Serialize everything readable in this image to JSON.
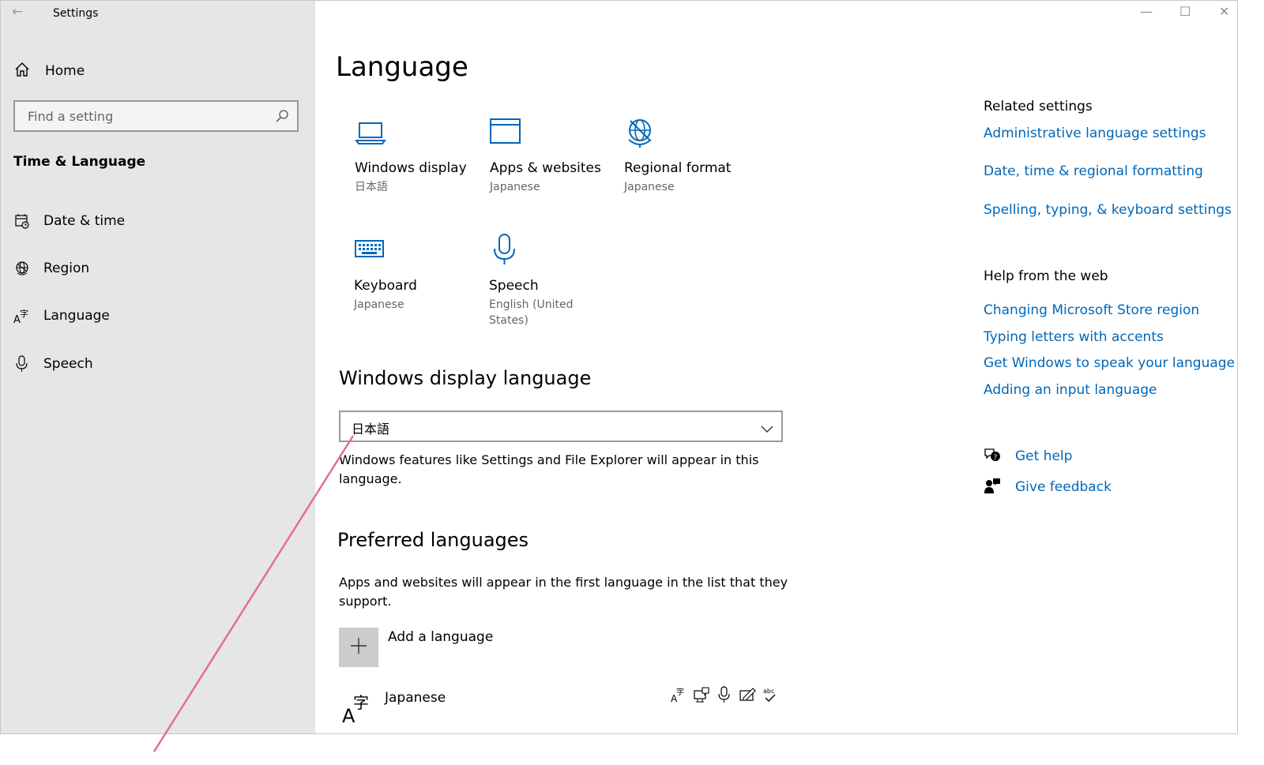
{
  "window": {
    "title": "Settings"
  },
  "sidebar": {
    "home_label": "Home",
    "search_placeholder": "Find a setting",
    "section_title": "Time & Language",
    "items": [
      {
        "label": "Date & time",
        "icon": "calendar-clock-icon"
      },
      {
        "label": "Region",
        "icon": "globe-icon"
      },
      {
        "label": "Language",
        "icon": "language-icon"
      },
      {
        "label": "Speech",
        "icon": "microphone-icon"
      }
    ]
  },
  "main": {
    "title": "Language",
    "tiles": [
      {
        "title": "Windows display",
        "subtitle": "日本語",
        "icon": "laptop-icon"
      },
      {
        "title": "Apps & websites",
        "subtitle": "Japanese",
        "icon": "window-icon"
      },
      {
        "title": "Regional format",
        "subtitle": "Japanese",
        "icon": "globe-icon"
      },
      {
        "title": "Keyboard",
        "subtitle": "Japanese",
        "icon": "keyboard-icon"
      },
      {
        "title": "Speech",
        "subtitle": "English (United States)",
        "icon": "microphone-icon"
      }
    ],
    "display_language": {
      "heading": "Windows display language",
      "selected": "日本語",
      "description": "Windows features like Settings and File Explorer will appear in this language."
    },
    "preferred": {
      "heading": "Preferred languages",
      "description": "Apps and websites will appear in the first language in the list that they support.",
      "add_label": "Add a language",
      "languages": [
        {
          "name": "Japanese",
          "features": [
            "display-language-icon",
            "text-to-speech-icon",
            "speech-recognition-icon",
            "handwriting-icon",
            "spellcheck-icon"
          ]
        }
      ]
    }
  },
  "related": {
    "heading": "Related settings",
    "links": [
      "Administrative language settings",
      "Date, time & regional formatting",
      "Spelling, typing, & keyboard settings"
    ]
  },
  "help": {
    "heading": "Help from the web",
    "links": [
      "Changing Microsoft Store region",
      "Typing letters with accents",
      "Get Windows to speak your language",
      "Adding an input language"
    ]
  },
  "support": {
    "get_help": "Get help",
    "give_feedback": "Give feedback"
  },
  "colors": {
    "accent": "#0067b8",
    "sidebar_bg": "#e6e6e6",
    "annotation": "#e8699f"
  }
}
